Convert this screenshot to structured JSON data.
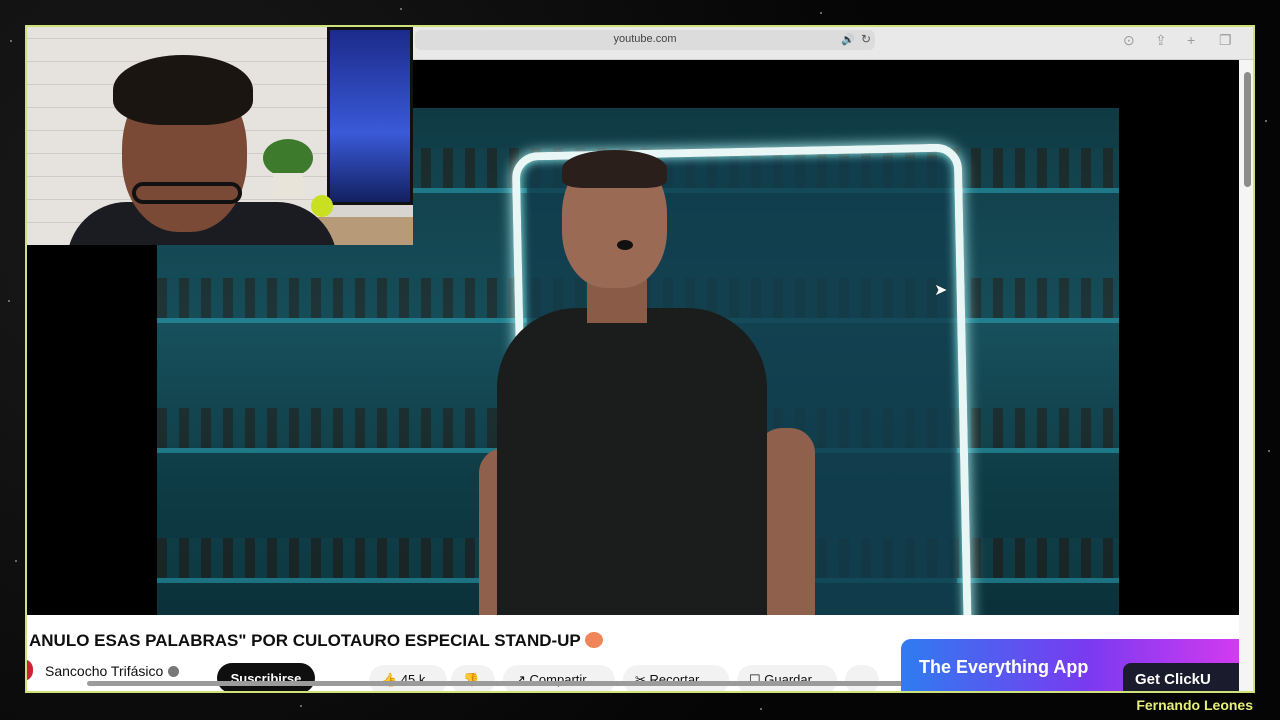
{
  "browser": {
    "url": "youtube.com"
  },
  "video": {
    "title": "ANULO ESAS PALABRAS\" POR CULOTAURO ESPECIAL STAND-UP"
  },
  "channel": {
    "name": "Sancocho Trifásico",
    "subscribe_label": "Suscribirse"
  },
  "actions": {
    "likes": "45 k",
    "share_label": "Compartir",
    "clip_label": "Recortar",
    "save_label": "Guardar",
    "more_label": "..."
  },
  "ad": {
    "headline": "The Everything App",
    "cta": "Get ClickU"
  },
  "watermark": {
    "text": "Fernando Leones"
  },
  "colors": {
    "frame_border": "#cfe27a",
    "watermark": "#e6ef7a",
    "subscribe_bg": "#0f0f0f",
    "ad_gradient_start": "#2f7cf0",
    "ad_gradient_end": "#d33af0"
  }
}
